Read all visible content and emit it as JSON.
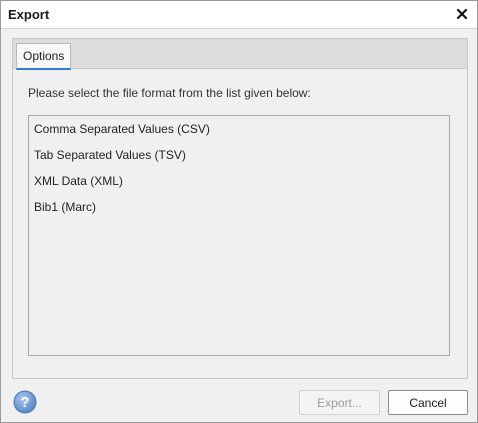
{
  "dialog": {
    "title": "Export",
    "close_icon": "close-icon"
  },
  "tabs": [
    {
      "label": "Options",
      "selected": true
    }
  ],
  "options": {
    "instructions": "Please select the file format from the list given below:",
    "formats": [
      "Comma Separated Values (CSV)",
      "Tab Separated Values (TSV)",
      "XML Data (XML)",
      "Bib1 (Marc)"
    ]
  },
  "footer": {
    "help_icon": "help-icon",
    "export_label": "Export...",
    "cancel_label": "Cancel"
  },
  "colors": {
    "tab_accent": "#2a7fd4",
    "help_icon": "#6b9bd2"
  }
}
